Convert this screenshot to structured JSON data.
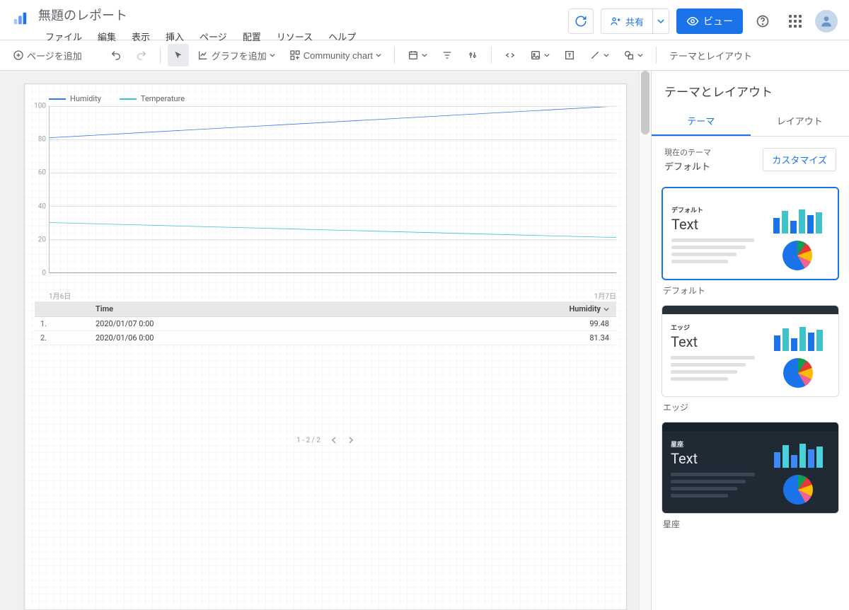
{
  "header": {
    "title": "無題のレポート",
    "menus": [
      "ファイル",
      "編集",
      "表示",
      "挿入",
      "ページ",
      "配置",
      "リソース",
      "ヘルプ"
    ],
    "share": "共有",
    "view": "ビュー"
  },
  "toolbar": {
    "add_page": "ページを追加",
    "add_chart": "グラフを追加",
    "community_chart": "Community chart",
    "theme_layout": "テーマとレイアウト"
  },
  "table": {
    "col_time": "Time",
    "col_value": "Humidity",
    "rows": [
      {
        "idx": "1.",
        "time": "2020/01/07 0:00",
        "value": "99.48"
      },
      {
        "idx": "2.",
        "time": "2020/01/06 0:00",
        "value": "81.34"
      }
    ],
    "pager": "1 - 2 / 2"
  },
  "panel": {
    "title": "テーマとレイアウト",
    "tab_theme": "テーマ",
    "tab_layout": "レイアウト",
    "current_label": "現在のテーマ",
    "current_value": "デフォルト",
    "customize": "カスタマイズ",
    "themes": [
      {
        "name": "デフォルト",
        "label": "デフォルト",
        "bg": "#ffffff",
        "hdr": "#ffffff",
        "fg": "#3c4043",
        "line": "#e0e0e0",
        "bars": [
          "#1a73e8",
          "#41c2cb",
          "#1a73e8",
          "#41c2cb",
          "#1a73e8",
          "#41c2cb"
        ],
        "selected": true
      },
      {
        "name": "エッジ",
        "label": "エッジ",
        "bg": "#ffffff",
        "hdr": "#263238",
        "fg": "#3c4043",
        "line": "#e0e0e0",
        "bars": [
          "#1a73e8",
          "#41c2cb",
          "#1a73e8",
          "#41c2cb",
          "#1a73e8",
          "#41c2cb"
        ],
        "selected": false
      },
      {
        "name": "星座",
        "label": "星座",
        "bg": "#202a34",
        "hdr": "#17222c",
        "fg": "#e8eaed",
        "line": "#394754",
        "bars": [
          "#3d89f7",
          "#4ad1dc",
          "#3d89f7",
          "#4ad1dc",
          "#3d89f7",
          "#4ad1dc"
        ],
        "selected": false
      }
    ]
  },
  "chart_data": {
    "type": "line",
    "title": "",
    "x": [
      "1月6日",
      "1月7日"
    ],
    "series": [
      {
        "name": "Humidity",
        "color": "#3b78e7",
        "values": [
          81,
          100
        ]
      },
      {
        "name": "Temperature",
        "color": "#41c2cb",
        "values": [
          30,
          21
        ]
      }
    ],
    "ylim": [
      0,
      100
    ],
    "yticks": [
      0,
      20,
      40,
      60,
      80,
      100
    ]
  }
}
